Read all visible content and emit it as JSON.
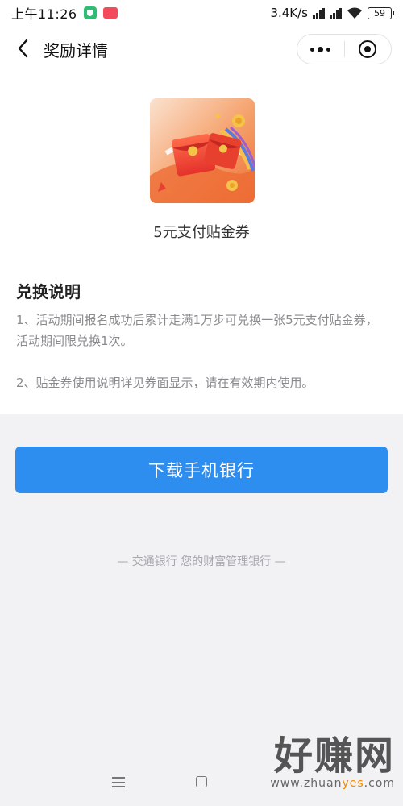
{
  "status_bar": {
    "time": "上午11:26",
    "network_speed": "3.4K/s",
    "signal_badge": "HD",
    "battery": "59",
    "icons": [
      "wechat-pay-icon",
      "app-notification-icon",
      "signal-icon",
      "wifi-icon",
      "battery-icon"
    ]
  },
  "nav": {
    "title": "奖励详情",
    "back_icon": "chevron-left-icon",
    "more_icon": "more-dots-icon",
    "close_icon": "target-close-icon"
  },
  "reward": {
    "name": "5元支付贴金券",
    "image_icon": "red-envelope-coupon-illustration"
  },
  "rules": {
    "title": "兑换说明",
    "items": [
      "1、活动期间报名成功后累计走满1万步可兑换一张5元支付贴金券，活动期间限兑换1次。",
      "2、贴金券使用说明详见券面显示，请在有效期内使用。"
    ]
  },
  "actions": {
    "download_label": "下载手机银行"
  },
  "footer": {
    "slogan": "— 交通银行 您的财富管理银行 —"
  },
  "system_nav": {
    "icons": [
      "menu-icon",
      "home-icon"
    ]
  },
  "watermark": {
    "logo": "好赚网",
    "url_prefix": "www.zhuan",
    "url_highlight": "yes",
    "url_suffix": ".com"
  },
  "colors": {
    "accent": "#2d8ef0",
    "page_bg": "#f2f2f4",
    "rule_text": "#8a8a8e",
    "coupon_orange": "#f07a3c",
    "coupon_red": "#e83e2e"
  }
}
